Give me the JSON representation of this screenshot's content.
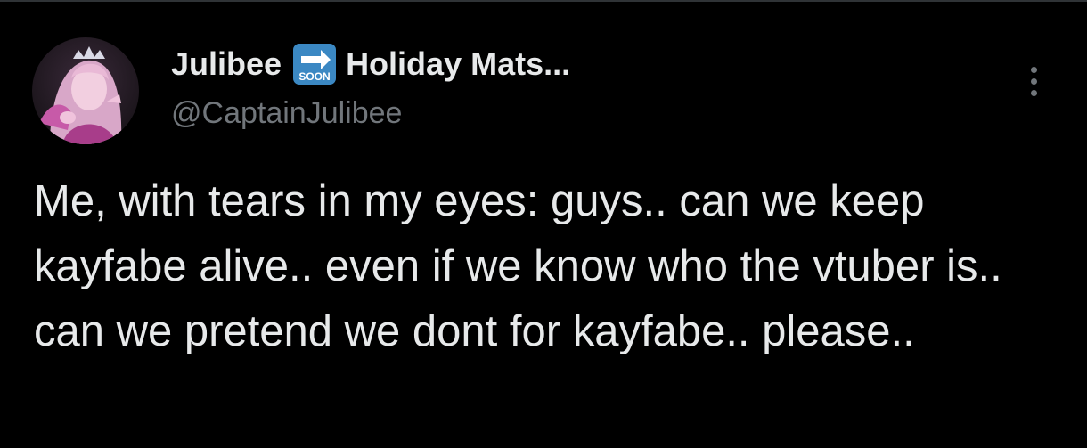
{
  "tweet": {
    "author": {
      "display_name": "Julibee",
      "name_suffix": "Holiday Mats...",
      "handle": "@CaptainJulibee",
      "badge_emoji": {
        "icon": "soon-arrow-emoji",
        "label": "SOON",
        "color": "#3b88c3"
      }
    },
    "text": "Me, with tears in my eyes: guys.. can we keep kayfabe alive.. even if we know who the vtuber is.. can we pretend we dont for kayfabe.. please..",
    "menu_icon": "more-vertical-icon"
  },
  "colors": {
    "background": "#000000",
    "text_primary": "#e7e9ea",
    "text_secondary": "#71767b",
    "divider": "#2f3336"
  }
}
